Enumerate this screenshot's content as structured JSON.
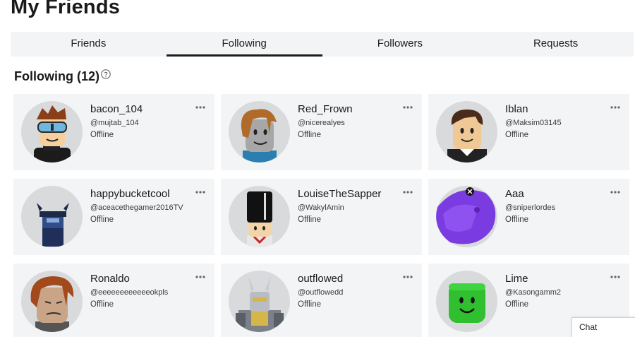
{
  "page": {
    "title": "My Friends"
  },
  "tabs": [
    {
      "label": "Friends",
      "active": false
    },
    {
      "label": "Following",
      "active": true
    },
    {
      "label": "Followers",
      "active": false
    },
    {
      "label": "Requests",
      "active": false
    }
  ],
  "section": {
    "title": "Following (12)",
    "help_icon": "question-circle-icon"
  },
  "cards": [
    {
      "name": "bacon_104",
      "handle": "@mujtab_104",
      "status": "Offline",
      "avatar_icon": "avatar-goggles"
    },
    {
      "name": "Red_Frown",
      "handle": "@nicerealyes",
      "status": "Offline",
      "avatar_icon": "avatar-bacon-hair"
    },
    {
      "name": "Iblan",
      "handle": "@Maksim03145",
      "status": "Offline",
      "avatar_icon": "avatar-brown-hair"
    },
    {
      "name": "happybucketcool",
      "handle": "@aceacethegamer2016TV",
      "status": "Offline",
      "avatar_icon": "avatar-horned-helmet"
    },
    {
      "name": "LouiseTheSapper",
      "handle": "@WakylAmin",
      "status": "Offline",
      "avatar_icon": "avatar-tall-hat"
    },
    {
      "name": "Aaa",
      "handle": "@sniperlordes",
      "status": "Offline",
      "avatar_icon": "avatar-purple-creature"
    },
    {
      "name": "Ronaldo",
      "handle": "@eeeeeeeeeeeeokpls",
      "status": "Offline",
      "avatar_icon": "avatar-ginger-hair"
    },
    {
      "name": "outflowed",
      "handle": "@outflowedd",
      "status": "Offline",
      "avatar_icon": "avatar-armored"
    },
    {
      "name": "Lime",
      "handle": "@Kasongamm2",
      "status": "Offline",
      "avatar_icon": "avatar-green-head"
    }
  ],
  "chat": {
    "label": "Chat"
  },
  "colors": {
    "card_bg": "#f2f4f5",
    "tab_bg": "#f2f4f5",
    "active_underline": "#1e1e1e",
    "avatar_bg": "#d8dadc"
  }
}
